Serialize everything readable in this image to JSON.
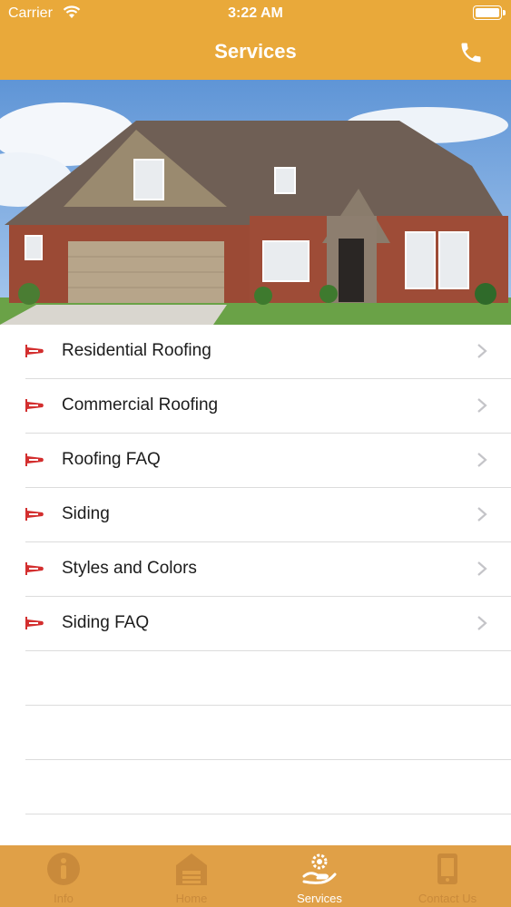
{
  "status_bar": {
    "carrier": "Carrier",
    "time": "3:22 AM"
  },
  "header": {
    "title": "Services",
    "call_icon": "phone-icon"
  },
  "hero": {
    "image": "house-photo"
  },
  "services": [
    {
      "label": "Residential Roofing"
    },
    {
      "label": "Commercial Roofing"
    },
    {
      "label": "Roofing FAQ"
    },
    {
      "label": "Siding"
    },
    {
      "label": "Styles and Colors"
    },
    {
      "label": "Siding FAQ"
    }
  ],
  "tabs": [
    {
      "label": "Info",
      "icon": "info-icon",
      "active": false
    },
    {
      "label": "Home",
      "icon": "home-icon",
      "active": false
    },
    {
      "label": "Services",
      "icon": "services-icon",
      "active": true
    },
    {
      "label": "Contact Us",
      "icon": "contact-icon",
      "active": false
    }
  ],
  "colors": {
    "header": "#e9a93a",
    "tabbar": "#e0a047",
    "marker": "#d32f2f"
  }
}
